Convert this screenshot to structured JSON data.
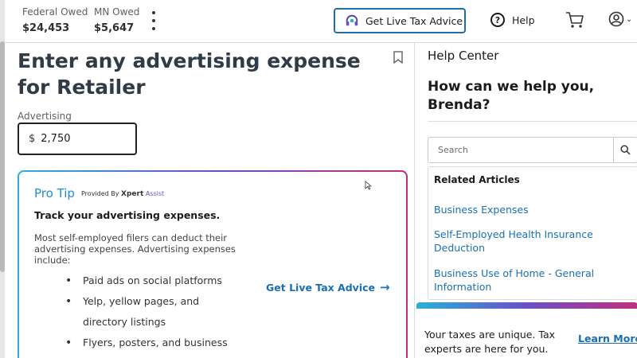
{
  "header": {
    "federal_label": "Federal Owed",
    "federal_amount": "$24,453",
    "mn_label": "MN Owed",
    "mn_amount": "$5,647",
    "advice_button": "Get Live Tax Advice",
    "help_label": "Help"
  },
  "main": {
    "title": "Enter any advertising expense for Retailer",
    "field_label": "Advertising",
    "currency_symbol": "$",
    "field_value": "2,750"
  },
  "pro_tip": {
    "title": "Pro Tip",
    "provided_by": "Provided By",
    "provider_brand": "Xpert",
    "provider_brand_suffix": "Assist",
    "heading": "Track your advertising expenses.",
    "body": "Most self-employed filers can deduct their advertising expenses. Advertising expenses include:",
    "bullets": [
      "Paid ads on social platforms",
      "Yelp, yellow pages, and directory listings",
      "Flyers, posters, and business cards"
    ],
    "link_label": "Get Live Tax Advice"
  },
  "help_center": {
    "title": "Help Center",
    "greeting": "How can we help you, Brenda?",
    "search_placeholder": "Search",
    "related_title": "Related Articles",
    "articles": [
      "Business Expenses",
      "Self-Employed Health Insurance Deduction",
      "Business Use of Home - General Information"
    ],
    "promo_text": "Your taxes are unique. Tax experts are here for you.",
    "learn_more": "Learn More"
  },
  "colors": {
    "accent_blue": "#1a6fb0",
    "title_text": "#2f3b46",
    "gradient": [
      "#2ab0d8",
      "#6a4fc8",
      "#c0307a"
    ]
  }
}
